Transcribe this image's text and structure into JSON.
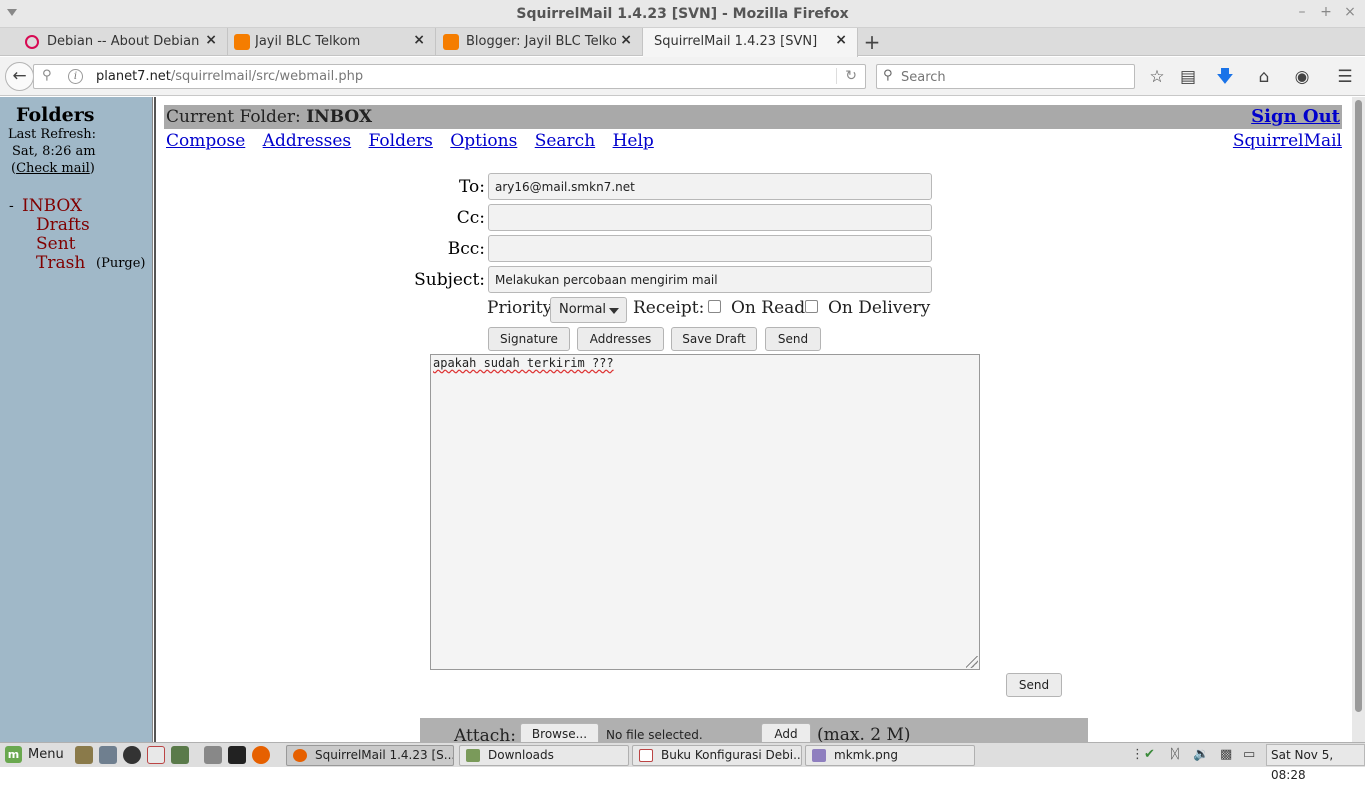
{
  "window": {
    "title": "SquirrelMail 1.4.23 [SVN] - Mozilla Firefox",
    "minimize": "–",
    "maximize": "+",
    "close": "×"
  },
  "tabs": [
    {
      "label": "Debian -- About Debian",
      "favicon_color": "#d70a53"
    },
    {
      "label": "Jayil BLC Telkom",
      "favicon_color": "#f57d00"
    },
    {
      "label": "Blogger: Jayil BLC Telkom...",
      "favicon_color": "#f57d00"
    },
    {
      "label": "SquirrelMail 1.4.23 [SVN]",
      "favicon_color": "#f5f5f5"
    }
  ],
  "tab_close_glyph": "×",
  "new_tab_glyph": "+",
  "nav": {
    "url_host": "planet7.net",
    "url_path": "/squirrelmail/src/webmail.php",
    "search_placeholder": "Search",
    "icons": [
      "back-icon",
      "key-icon",
      "info-icon",
      "reload-icon",
      "search-icon",
      "bookmark-star-icon",
      "reading-list-icon",
      "download-icon",
      "home-icon",
      "pocket-icon",
      "hamburger-menu-icon"
    ]
  },
  "left_frame": {
    "title": "Folders",
    "last_refresh_label": "Last Refresh:",
    "last_refresh_time": "Sat, 8:26 am",
    "check_mail_open": "(",
    "check_mail_label": "Check mail",
    "check_mail_close": ")",
    "dash": "-",
    "folders": [
      "INBOX",
      "Drafts",
      "Sent",
      "Trash"
    ],
    "purge_label": "(Purge)"
  },
  "right_frame": {
    "current_folder_label": "Current Folder:",
    "current_folder": "INBOX",
    "sign_out": "Sign Out",
    "menu": [
      "Compose",
      "Addresses",
      "Folders",
      "Options",
      "Search",
      "Help"
    ],
    "brand_link": "SquirrelMail"
  },
  "compose": {
    "to_label": "To:",
    "to_value": "ary16@mail.smkn7.net",
    "cc_label": "Cc:",
    "cc_value": "",
    "bcc_label": "Bcc:",
    "bcc_value": "",
    "subject_label": "Subject:",
    "subject_value": "Melakukan percobaan mengirim mail",
    "priority_label": "Priority",
    "priority_value": "Normal",
    "receipt_label": "Receipt:",
    "on_read_label": "On Read",
    "on_delivery_label": "On Delivery",
    "on_read_checked": false,
    "on_delivery_checked": false,
    "buttons": {
      "signature": "Signature",
      "addresses": "Addresses",
      "save_draft": "Save Draft",
      "send": "Send"
    },
    "body_text": "apakah sudah terkirim ???",
    "send_bottom": "Send",
    "attach_label": "Attach:",
    "browse_button": "Browse...",
    "no_file": "No file selected.",
    "add_button": "Add",
    "max_size": "(max. 2 M)"
  },
  "taskbar": {
    "menu_label": "Menu",
    "tasks": [
      {
        "label": "SquirrelMail 1.4.23 [S...",
        "icon_color": "#e66000",
        "active": true
      },
      {
        "label": "Downloads",
        "icon_color": "#7a9a5a",
        "active": false
      },
      {
        "label": "Buku Konfigurasi Debi...",
        "icon_color": "#ffffff",
        "active": false
      },
      {
        "label": "mkmk.png",
        "icon_color": "#8f7fbf",
        "active": false
      }
    ],
    "clock": "Sat Nov  5, 08:28"
  }
}
